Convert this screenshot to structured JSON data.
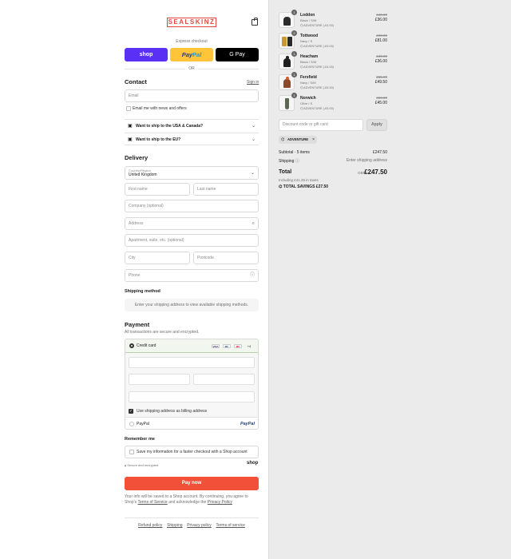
{
  "brand": {
    "logo": "SEALSKINZ"
  },
  "express": {
    "label": "Express checkout",
    "shop": "shop",
    "paypal_a": "Pay",
    "paypal_b": "Pal",
    "gpay": "G Pay",
    "or": "OR"
  },
  "contact": {
    "heading": "Contact",
    "signin": "Sign in",
    "email_placeholder": "Email",
    "news_label": "Email me with news and offers"
  },
  "shipping_questions": [
    {
      "label": "Want to ship to the USA & Canada?"
    },
    {
      "label": "Want to ship to the EU?"
    }
  ],
  "delivery": {
    "heading": "Delivery",
    "country_label": "Country/Region",
    "country_value": "United Kingdom",
    "first_name": "First name",
    "last_name": "Last name",
    "company": "Company (optional)",
    "address": "Address",
    "apartment": "Apartment, suite, etc. (optional)",
    "city": "City",
    "postcode": "Postcode",
    "phone": "Phone"
  },
  "shipping_method": {
    "heading": "Shipping method",
    "notice": "Enter your shipping address to view available shipping methods."
  },
  "payment": {
    "heading": "Payment",
    "subtitle": "All transactions are secure and encrypted.",
    "credit_card": "Credit card",
    "cards": [
      "VISA",
      "MC",
      "MC"
    ],
    "more_cards": "+4",
    "billing_same": "Use shipping address as billing address",
    "paypal": "PayPal",
    "paypal_logo": "PayPal"
  },
  "remember": {
    "heading": "Remember me",
    "save_label": "Save my information for a faster checkout with a Shop account",
    "secure": "Secure and encrypted",
    "shop": "shop"
  },
  "pay_now": "Pay now",
  "legal": {
    "text1": "Your info will be saved to a Shop account. By continuing, you agree to Shop's",
    "terms": "Terms of Service",
    "text2": "and acknowledge the",
    "privacy": "Privacy Policy"
  },
  "footer": {
    "links": [
      "Refund policy",
      "Shipping",
      "Privacy policy",
      "Terms of service"
    ]
  },
  "cart": {
    "items": [
      {
        "qty": "1",
        "name": "Loddon",
        "variant": "Black / S/M",
        "discount": "ADVENTURE (-£4.00)",
        "old_price": "£40.00",
        "price": "£36.00",
        "color": "#2b2b2b"
      },
      {
        "qty": "2",
        "name": "Tottwood",
        "variant": "Navy / S",
        "discount": "ADVENTURE (-£9.00)",
        "old_price": "£90.00",
        "price": "£81.00",
        "color": "#c99a2e"
      },
      {
        "qty": "1",
        "name": "Heacham",
        "variant": "Black / S/M",
        "discount": "ADVENTURE (-£4.00)",
        "old_price": "£40.00",
        "price": "£36.00",
        "color": "#1f1f1f"
      },
      {
        "qty": "1",
        "name": "Fersfield",
        "variant": "Navy / S/M",
        "discount": "ADVENTURE (-£5.50)",
        "old_price": "£55.00",
        "price": "£49.50",
        "color": "#8a4a2a"
      },
      {
        "qty": "1",
        "name": "Norwich",
        "variant": "Olive / S",
        "discount": "ADVENTURE (-£5.00)",
        "old_price": "£50.00",
        "price": "£45.00",
        "color": "#5c6650"
      }
    ],
    "discount_placeholder": "Discount code or gift card",
    "apply": "Apply",
    "applied_code": "ADVENTURE",
    "subtotal_label": "Subtotal · 5 items",
    "subtotal_value": "£247.50",
    "shipping_label": "Shipping",
    "shipping_value": "Enter shipping address",
    "total_label": "Total",
    "currency": "GBP",
    "total_value": "£247.50",
    "taxes": "Including £41.25 in taxes",
    "savings_label": "TOTAL SAVINGS",
    "savings_value": "£27.50"
  }
}
